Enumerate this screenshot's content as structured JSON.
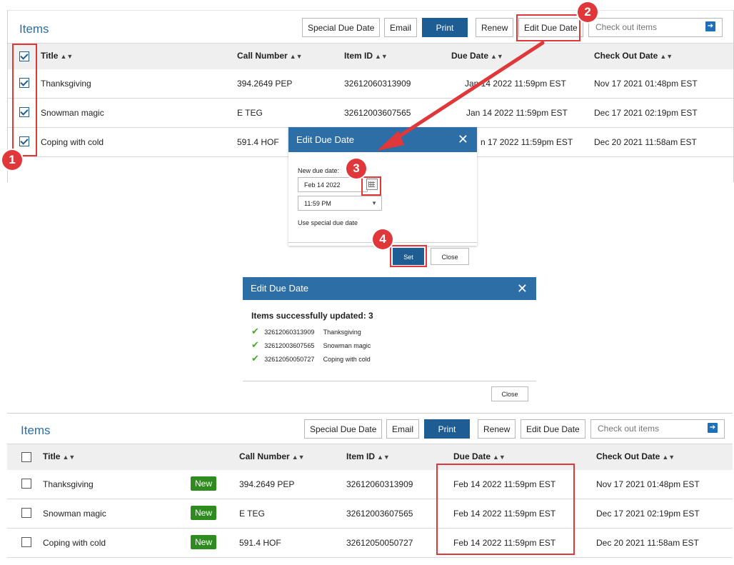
{
  "top_panel": {
    "title": "Items",
    "buttons": {
      "special_due_date": "Special Due Date",
      "email": "Email",
      "print": "Print",
      "renew": "Renew",
      "edit_due_date": "Edit Due Date"
    },
    "checkout_placeholder": "Check out items",
    "columns": {
      "title": "Title",
      "call_number": "Call Number",
      "item_id": "Item ID",
      "due_date": "Due Date",
      "check_out_date": "Check Out Date"
    },
    "rows": [
      {
        "title": "Thanksgiving",
        "call_number": "394.2649 PEP",
        "item_id": "32612060313909",
        "due_date": "Jan 14 2022 11:59pm EST",
        "check_out_date": "Nov 17 2021 01:48pm EST"
      },
      {
        "title": "Snowman magic",
        "call_number": "E TEG",
        "item_id": "32612003607565",
        "due_date": "Jan 14 2022 11:59pm EST",
        "check_out_date": "Dec 17 2021 02:19pm EST"
      },
      {
        "title": "Coping with cold",
        "call_number": "591.4 HOF",
        "item_id": "",
        "due_date": "n 17 2022 11:59pm EST",
        "check_out_date": "Dec 20 2021 11:58am EST"
      }
    ]
  },
  "edit_dialog": {
    "title": "Edit Due Date",
    "label": "New due date:",
    "date_value": "Feb 14 2022",
    "time_value": "11:59 PM",
    "special_label": "Use special due date",
    "set_label": "Set",
    "close_label": "Close"
  },
  "result_dialog": {
    "title": "Edit Due Date",
    "heading": "Items successfully updated: 3",
    "items": [
      {
        "id": "32612060313909",
        "title": "Thanksgiving"
      },
      {
        "id": "32612003607565",
        "title": "Snowman magic"
      },
      {
        "id": "32612050050727",
        "title": "Coping with cold"
      }
    ],
    "close_label": "Close"
  },
  "bottom_panel": {
    "title": "Items",
    "buttons": {
      "special_due_date": "Special Due Date",
      "email": "Email",
      "print": "Print",
      "renew": "Renew",
      "edit_due_date": "Edit Due Date"
    },
    "checkout_placeholder": "Check out items",
    "columns": {
      "title": "Title",
      "call_number": "Call Number",
      "item_id": "Item ID",
      "due_date": "Due Date",
      "check_out_date": "Check Out Date"
    },
    "new_badge": "New",
    "rows": [
      {
        "title": "Thanksgiving",
        "call_number": "394.2649 PEP",
        "item_id": "32612060313909",
        "due_date": "Feb 14 2022 11:59pm EST",
        "check_out_date": "Nov 17 2021 01:48pm EST"
      },
      {
        "title": "Snowman magic",
        "call_number": "E TEG",
        "item_id": "32612003607565",
        "due_date": "Feb 14 2022 11:59pm EST",
        "check_out_date": "Dec 17 2021 02:19pm EST"
      },
      {
        "title": "Coping with cold",
        "call_number": "591.4 HOF",
        "item_id": "32612050050727",
        "due_date": "Feb 14 2022 11:59pm EST",
        "check_out_date": "Dec 20 2021 11:58am EST"
      }
    ]
  },
  "callouts": [
    "1",
    "2",
    "3",
    "4"
  ],
  "colors": {
    "accent": "#1d5d93",
    "title_blue": "#2a6fa8",
    "dialog_header": "#2c6ea5",
    "callout_red": "#e0373b",
    "new_badge": "#2e8b1e",
    "check_green": "#4aa832"
  }
}
